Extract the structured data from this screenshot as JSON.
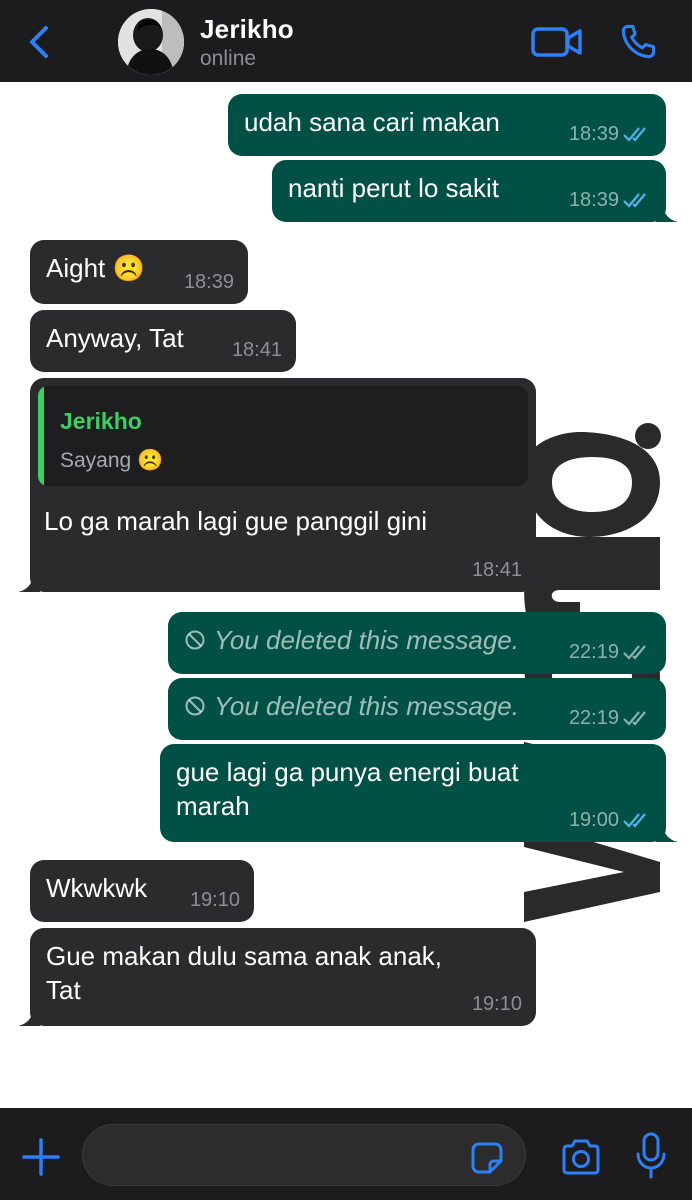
{
  "header": {
    "contact_name": "Jerikho",
    "status": "online",
    "accent_color": "#2f7ff5"
  },
  "messages": [
    {
      "direction": "outgoing",
      "text": "udah sana cari makan",
      "time": "18:39",
      "status": "read"
    },
    {
      "direction": "outgoing",
      "text": "nanti perut lo sakit",
      "time": "18:39",
      "status": "read"
    },
    {
      "direction": "incoming",
      "text": "Aight ☹️",
      "time": "18:39"
    },
    {
      "direction": "incoming",
      "text": "Anyway, Tat",
      "time": "18:41"
    },
    {
      "direction": "incoming",
      "text": "Lo ga marah lagi gue panggil gini",
      "time": "18:41",
      "reply_to": {
        "name": "Jerikho",
        "text": "Sayang ☹️"
      }
    },
    {
      "direction": "outgoing",
      "text": "You deleted this message.",
      "time": "22:19",
      "deleted": true
    },
    {
      "direction": "outgoing",
      "text": "You deleted this message.",
      "time": "22:19",
      "deleted": true
    },
    {
      "direction": "outgoing",
      "text": "gue lagi ga punya energi buat\nmarah",
      "time": "19:00",
      "status": "read"
    },
    {
      "direction": "incoming",
      "text": "Wkwkwk",
      "time": "19:10"
    },
    {
      "direction": "incoming",
      "text": "Gue makan dulu sama anak anak,\nTat",
      "time": "19:10"
    }
  ],
  "watermark": "word.",
  "colors": {
    "outgoing_bubble": "#005046",
    "incoming_bubble": "#2b2b2d",
    "read_ticks": "#4fb6ec",
    "reply_name": "#3ccf63"
  },
  "input": {
    "placeholder": "",
    "value": ""
  }
}
